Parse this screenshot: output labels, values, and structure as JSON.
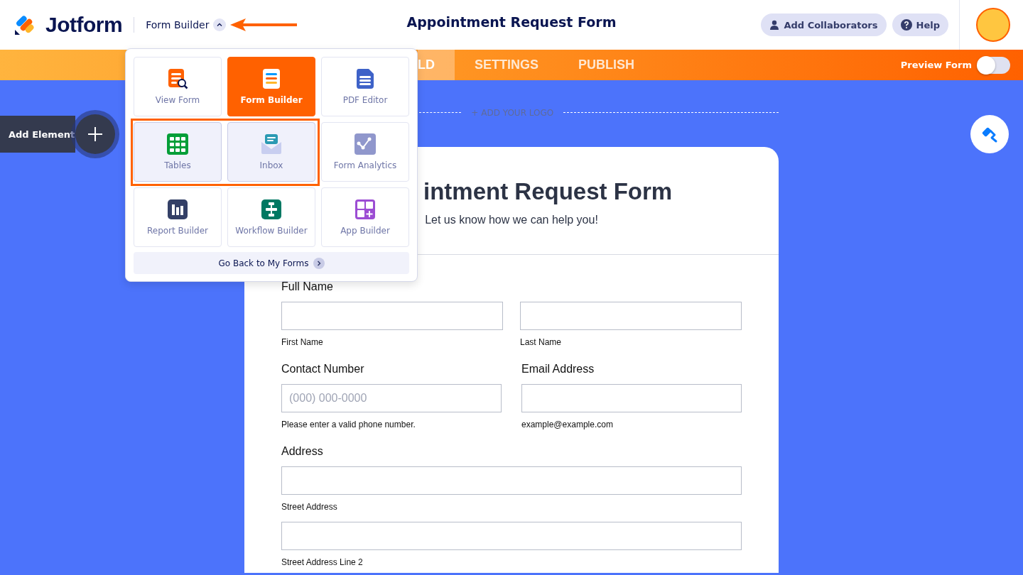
{
  "header": {
    "logo": "Jotform",
    "app_switcher": {
      "label": "Form Builder",
      "expanded": true
    },
    "form_title": "Appointment Request Form",
    "buttons": [
      {
        "label": "Add Collaborators"
      },
      {
        "label": "Help"
      }
    ]
  },
  "nav": {
    "tabs": [
      {
        "label": "LD",
        "selected": true
      },
      {
        "label": "SETTINGS",
        "selected": false
      },
      {
        "label": "PUBLISH",
        "selected": false
      }
    ],
    "preview": {
      "label": "Preview Form",
      "on": false
    }
  },
  "add_element": {
    "label": "Add Element"
  },
  "logo_placeholder": "+ ADD YOUR LOGO",
  "form": {
    "title": "intment Request Form",
    "subtitle": "Let us know how we can help you!",
    "rows": [
      {
        "columns": [
          {
            "kind": "split",
            "label": "Full Name",
            "inputs": [
              {
                "sublabel": "First Name"
              },
              {
                "sublabel": "Last Name"
              }
            ]
          }
        ]
      },
      {
        "columns": [
          {
            "kind": "stack",
            "label": "Contact Number",
            "inputs": [
              {
                "placeholder": "(000) 000-0000",
                "sublabel": "Please enter a valid phone number."
              }
            ]
          },
          {
            "kind": "stack",
            "label": "Email Address",
            "inputs": [
              {
                "sublabel": "example@example.com"
              }
            ]
          }
        ]
      },
      {
        "columns": [
          {
            "kind": "stack",
            "label": "Address",
            "inputs": [
              {
                "sublabel": "Street Address"
              },
              {
                "sublabel": "Street Address Line 2"
              }
            ]
          }
        ]
      }
    ]
  },
  "popup": {
    "items": [
      {
        "label": "View Form",
        "selected": false,
        "highlighted": false
      },
      {
        "label": "Form Builder",
        "selected": true,
        "highlighted": false
      },
      {
        "label": "PDF Editor",
        "selected": false,
        "highlighted": false
      },
      {
        "label": "Tables",
        "selected": false,
        "highlighted": true
      },
      {
        "label": "Inbox",
        "selected": false,
        "highlighted": true
      },
      {
        "label": "Form Analytics",
        "selected": false,
        "highlighted": false
      },
      {
        "label": "Report Builder",
        "selected": false,
        "highlighted": false
      },
      {
        "label": "Workflow Builder",
        "selected": false,
        "highlighted": false
      },
      {
        "label": "App Builder",
        "selected": false,
        "highlighted": false
      }
    ],
    "footer": "Go Back to My Forms"
  }
}
